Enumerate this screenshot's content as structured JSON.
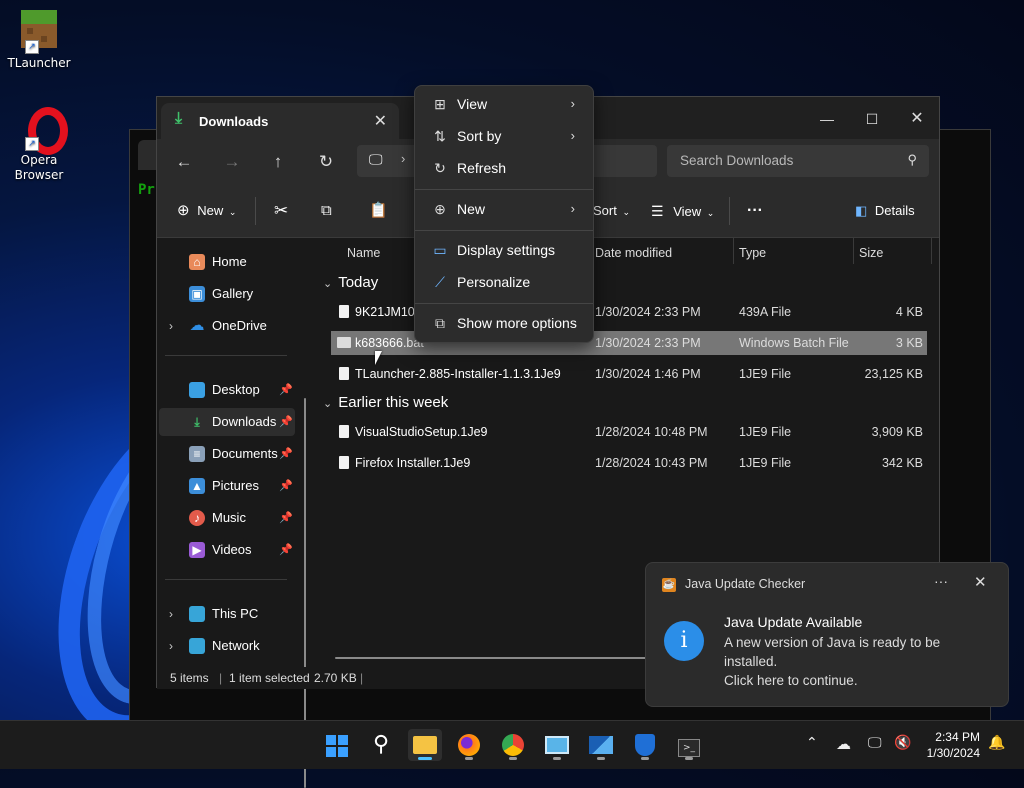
{
  "desktop": {
    "icons": [
      {
        "label": "TLauncher"
      },
      {
        "label": "Opera Browser"
      }
    ]
  },
  "terminal": {
    "prompt_fragment": "Pr"
  },
  "explorer": {
    "tab_title": "Downloads",
    "search_placeholder": "Search Downloads",
    "commands": {
      "new": "New",
      "sort": "Sort",
      "view": "View",
      "details": "Details"
    },
    "nav": {
      "top": [
        {
          "label": "Home"
        },
        {
          "label": "Gallery"
        },
        {
          "label": "OneDrive"
        }
      ],
      "quick": [
        {
          "label": "Desktop"
        },
        {
          "label": "Downloads"
        },
        {
          "label": "Documents"
        },
        {
          "label": "Pictures"
        },
        {
          "label": "Music"
        },
        {
          "label": "Videos"
        }
      ],
      "bottom": [
        {
          "label": "This PC"
        },
        {
          "label": "Network"
        }
      ]
    },
    "columns": {
      "name": "Name",
      "date": "Date modified",
      "type": "Type",
      "size": "Size"
    },
    "groups": [
      {
        "label": "Today",
        "files": [
          {
            "name": "9K21JM10B",
            "date": "1/30/2024 2:33 PM",
            "type": "439A File",
            "size": "4 KB"
          },
          {
            "name": "k683666.bat",
            "date": "1/30/2024 2:33 PM",
            "type": "Windows Batch File",
            "size": "3 KB"
          },
          {
            "name": "TLauncher-2.885-Installer-1.1.3.1Je9",
            "date": "1/30/2024 1:46 PM",
            "type": "1JE9 File",
            "size": "23,125 KB"
          }
        ]
      },
      {
        "label": "Earlier this week",
        "files": [
          {
            "name": "VisualStudioSetup.1Je9",
            "date": "1/28/2024 10:48 PM",
            "type": "1JE9 File",
            "size": "3,909 KB"
          },
          {
            "name": "Firefox Installer.1Je9",
            "date": "1/28/2024 10:43 PM",
            "type": "1JE9 File",
            "size": "342 KB"
          }
        ]
      }
    ],
    "status": {
      "items": "5 items",
      "selected": "1 item selected",
      "size": "2.70 KB"
    }
  },
  "context_menu": {
    "items": [
      {
        "label": "View",
        "icon": "grid-icon"
      },
      {
        "label": "Sort by",
        "icon": "sort-icon"
      },
      {
        "label": "Refresh",
        "icon": "refresh-icon"
      },
      {
        "label": "New",
        "icon": "plus-circle-icon"
      },
      {
        "label": "Display settings",
        "icon": "display-icon"
      },
      {
        "label": "Personalize",
        "icon": "brush-icon"
      },
      {
        "label": "Show more options",
        "icon": "expand-icon"
      }
    ]
  },
  "toast": {
    "app_name": "Java Update Checker",
    "title": "Java Update Available",
    "body_1": "A new version of Java is ready to be installed.",
    "body_2": "Click here to continue."
  },
  "taskbar": {
    "time": "2:34 PM",
    "date": "1/30/2024",
    "apps": [
      "start-icon",
      "search-icon",
      "file-explorer-icon",
      "firefox-icon",
      "chrome-icon",
      "control-panel-icon",
      "resource-monitor-icon",
      "defender-icon",
      "terminal-icon"
    ]
  },
  "colors": {
    "selection": "#777777",
    "accent": "#4cc2ff",
    "toast_icon": "#2b8ee8"
  }
}
